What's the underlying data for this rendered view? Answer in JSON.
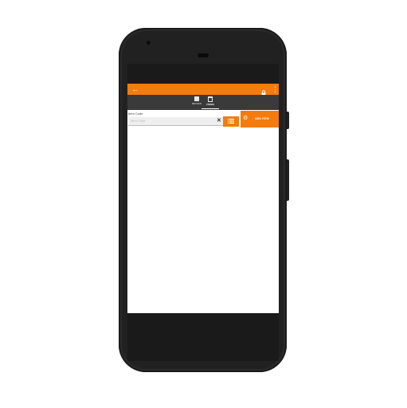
{
  "app_bar": {
    "back_icon": "arrow-left-icon",
    "lock_icon": "lock-icon",
    "more_icon": "more-vert-icon"
  },
  "tabs": [
    {
      "label": "REVIEW",
      "icon": "square-icon",
      "active": false
    },
    {
      "label": "ITEMS",
      "icon": "calendar-icon",
      "active": true
    }
  ],
  "form": {
    "field_label": "Item Code",
    "input_placeholder": "Item Code",
    "clear_icon": "close-icon",
    "list_button_icon": "list-icon"
  },
  "add_button": {
    "label": "ADD ITEM",
    "icon": "gear-icon"
  },
  "colors": {
    "accent": "#f57c0c",
    "tab_bar": "#3a3a3a",
    "phone_body": "#2a2a2a"
  }
}
